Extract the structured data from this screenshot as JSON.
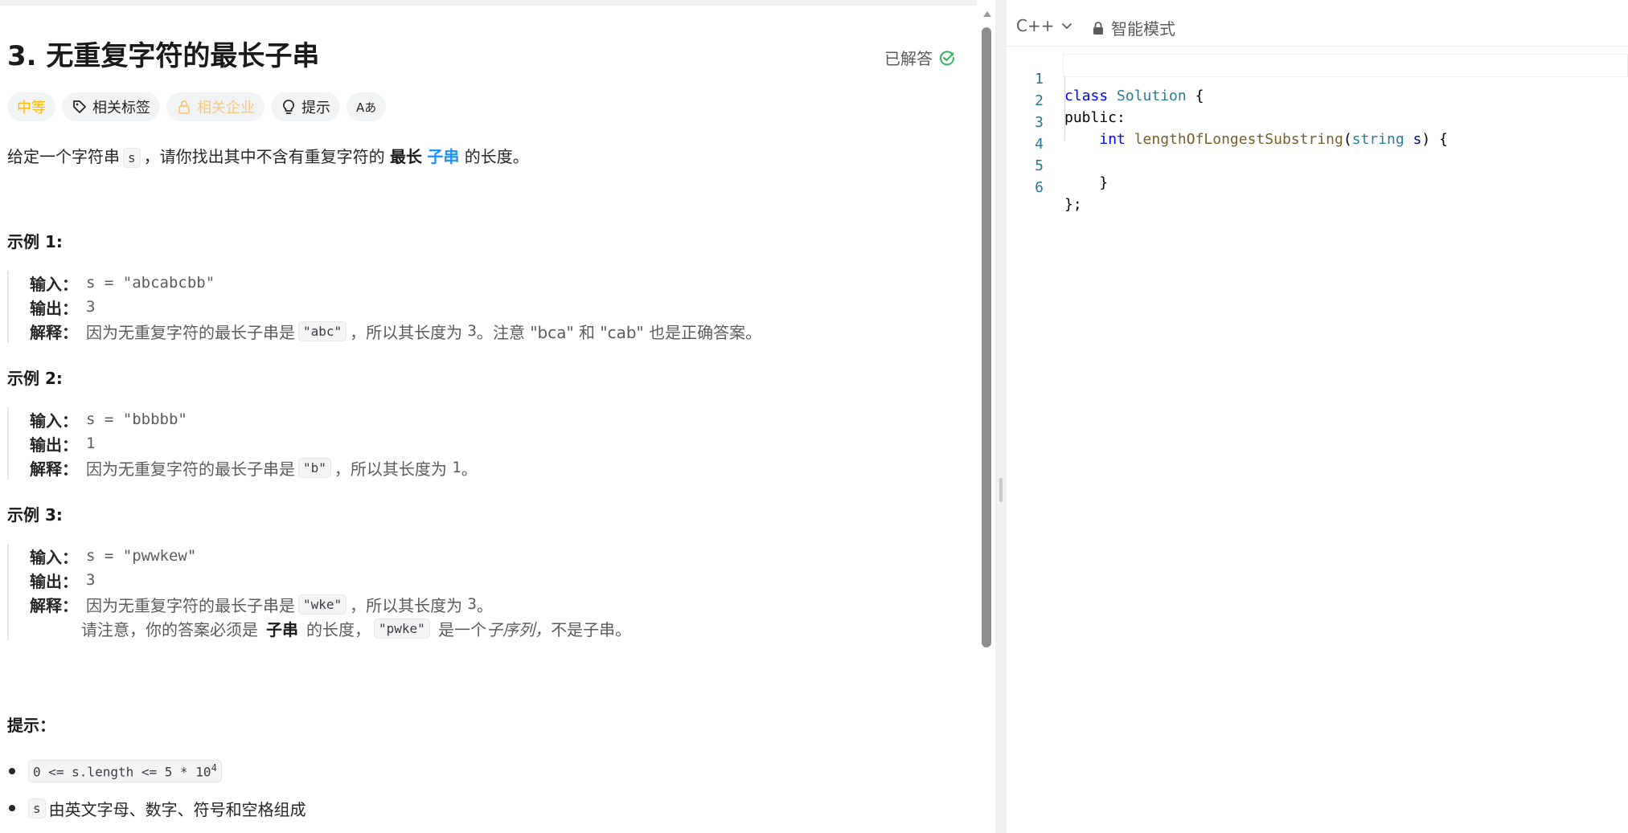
{
  "problem": {
    "title": "3. 无重复字符的最长子串",
    "solved_label": "已解答",
    "tags": {
      "difficulty": "中等",
      "topics": "相关标签",
      "companies": "相关企业",
      "hint": "提示",
      "translate": "Aあ"
    },
    "description": {
      "pre": "给定一个字符串",
      "var": "s",
      "mid": "，请你找出其中不含有重复字符的",
      "bold": "最长",
      "link": "子串",
      "post": "的长度。"
    },
    "examples": [
      {
        "title": "示例 1:",
        "input_label": "输入：",
        "input": "s = \"abcabcbb\"",
        "output_label": "输出：",
        "output": "3",
        "explain_label": "解释：",
        "explain_pre": "因为无重复字符的最长子串是",
        "explain_code": "\"abc\"",
        "explain_post": "，所以其长度为",
        "explain_num": "3",
        "explain_tail": "。注意 \"bca\" 和 \"cab\" 也是正确答案。"
      },
      {
        "title": "示例 2:",
        "input_label": "输入：",
        "input": "s = \"bbbbb\"",
        "output_label": "输出：",
        "output": "1",
        "explain_label": "解释：",
        "explain_pre": "因为无重复字符的最长子串是",
        "explain_code": "\"b\"",
        "explain_post": "，所以其长度为",
        "explain_num": "1",
        "explain_tail": "。"
      },
      {
        "title": "示例 3:",
        "input_label": "输入：",
        "input": "s = \"pwwkew\"",
        "output_label": "输出：",
        "output": "3",
        "explain_label": "解释：",
        "explain_pre": "因为无重复字符的最长子串是",
        "explain_code": "\"wke\"",
        "explain_post": "，所以其长度为",
        "explain_num": "3",
        "explain_tail": "。",
        "note_pre": "请注意，你的答案必须是",
        "note_bold": "子串",
        "note_mid": "的长度，",
        "note_code": "\"pwke\"",
        "note_post": "是一个",
        "note_italic": "子序列，",
        "note_tail": "不是子串。"
      }
    ],
    "hints_title": "提示：",
    "constraints": {
      "c1_code": "0 <= s.length <= 5 * 10",
      "c1_exp": "4",
      "c2_code": "s",
      "c2_text": "由英文字母、数字、符号和空格组成"
    }
  },
  "editor": {
    "language": "C++",
    "mode": "智能模式",
    "lines": [
      "1",
      "2",
      "3",
      "4",
      "5",
      "6"
    ],
    "code": {
      "l1_kw": "class",
      "l1_name": "Solution",
      "l1_brace": " {",
      "l2": "public:",
      "l3_indent": "    ",
      "l3_type": "int",
      "l3_fn": "lengthOfLongestSubstring",
      "l3_open": "(",
      "l3_ptype": "string",
      "l3_param": "s",
      "l3_close": ") {",
      "l4": "",
      "l5": "    }",
      "l6": "};"
    }
  },
  "colors": {
    "difficulty_medium": "#ffb800",
    "link_blue": "#1a90ff",
    "solved_green": "#2db55d",
    "keyword": "#0000ff",
    "type": "#267f99",
    "function": "#795e26",
    "line_number": "#237893"
  }
}
